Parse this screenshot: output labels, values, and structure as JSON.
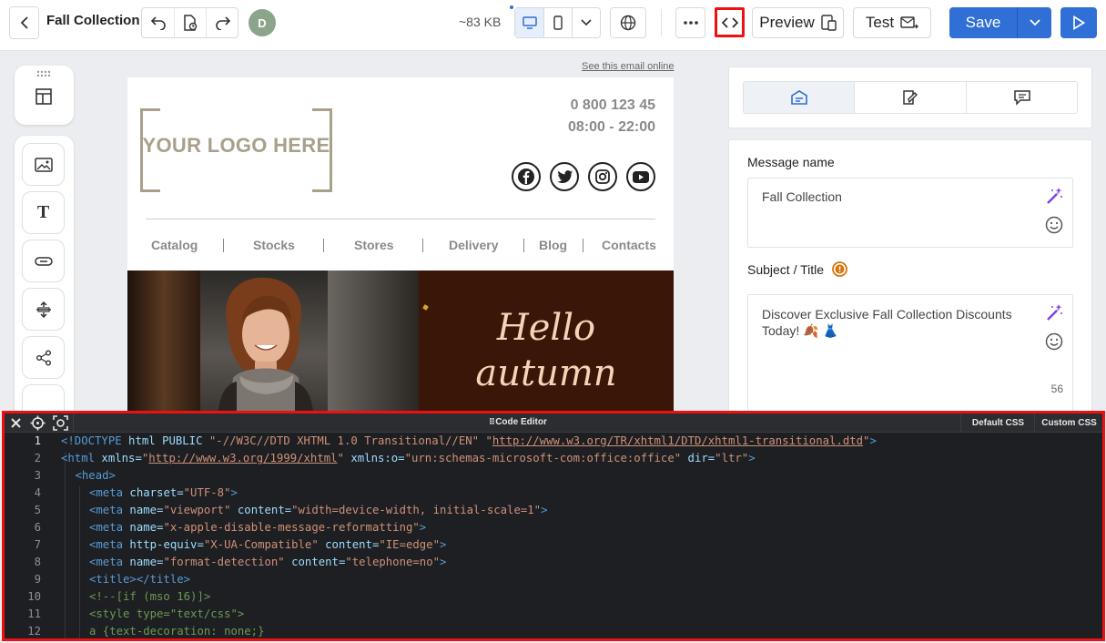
{
  "header": {
    "title": "Fall Collection",
    "avatar_initial": "D",
    "size": "~83 KB",
    "preview_label": "Preview",
    "test_label": "Test",
    "save_label": "Save"
  },
  "email": {
    "see_online": "See this email online",
    "logo_text": "YOUR LOGO HERE",
    "phone": "0 800 123 45",
    "hours": "08:00 - 22:00",
    "menu": [
      "Catalog",
      "Stocks",
      "Stores",
      "Delivery",
      "Blog",
      "Contacts"
    ],
    "hero_line1": "Hello",
    "hero_line2": "autumn"
  },
  "panel": {
    "message_name_label": "Message name",
    "message_name_value": "Fall Collection",
    "subject_label": "Subject / Title",
    "subject_value": "Discover Exclusive Fall Collection Discounts Today! 🍂 👗",
    "char_count": "56"
  },
  "editor": {
    "title": "Code Editor",
    "default_css": "Default CSS",
    "custom_css": "Custom CSS",
    "lines": [
      {
        "n": "1",
        "indent": 0,
        "parts": [
          [
            "tag",
            "<!DOCTYPE "
          ],
          [
            "attr",
            "html PUBLIC "
          ],
          [
            "str",
            "\"-//W3C//DTD XHTML 1.0 Transitional//EN\""
          ],
          [
            "plain",
            " "
          ],
          [
            "str",
            "\""
          ],
          [
            "url",
            "http://www.w3.org/TR/xhtml1/DTD/xhtml1-transitional.dtd"
          ],
          [
            "str",
            "\""
          ],
          [
            "tag",
            ">"
          ]
        ]
      },
      {
        "n": "2",
        "indent": 0,
        "parts": [
          [
            "tag",
            "<html "
          ],
          [
            "attr",
            "xmlns="
          ],
          [
            "str",
            "\""
          ],
          [
            "url",
            "http://www.w3.org/1999/xhtml"
          ],
          [
            "str",
            "\""
          ],
          [
            "attr",
            " xmlns:o="
          ],
          [
            "str",
            "\"urn:schemas-microsoft-com:office:office\""
          ],
          [
            "attr",
            " dir="
          ],
          [
            "str",
            "\"ltr\""
          ],
          [
            "tag",
            ">"
          ]
        ]
      },
      {
        "n": "3",
        "indent": 1,
        "parts": [
          [
            "tag",
            "<head>"
          ]
        ]
      },
      {
        "n": "4",
        "indent": 2,
        "parts": [
          [
            "tag",
            "<meta "
          ],
          [
            "attr",
            "charset="
          ],
          [
            "str",
            "\"UTF-8\""
          ],
          [
            "tag",
            ">"
          ]
        ]
      },
      {
        "n": "5",
        "indent": 2,
        "parts": [
          [
            "tag",
            "<meta "
          ],
          [
            "attr",
            "name="
          ],
          [
            "str",
            "\"viewport\""
          ],
          [
            "attr",
            " content="
          ],
          [
            "str",
            "\"width=device-width, initial-scale=1\""
          ],
          [
            "tag",
            ">"
          ]
        ]
      },
      {
        "n": "6",
        "indent": 2,
        "parts": [
          [
            "tag",
            "<meta "
          ],
          [
            "attr",
            "name="
          ],
          [
            "str",
            "\"x-apple-disable-message-reformatting\""
          ],
          [
            "tag",
            ">"
          ]
        ]
      },
      {
        "n": "7",
        "indent": 2,
        "parts": [
          [
            "tag",
            "<meta "
          ],
          [
            "attr",
            "http-equiv="
          ],
          [
            "str",
            "\"X-UA-Compatible\""
          ],
          [
            "attr",
            " content="
          ],
          [
            "str",
            "\"IE=edge\""
          ],
          [
            "tag",
            ">"
          ]
        ]
      },
      {
        "n": "8",
        "indent": 2,
        "parts": [
          [
            "tag",
            "<meta "
          ],
          [
            "attr",
            "name="
          ],
          [
            "str",
            "\"format-detection\""
          ],
          [
            "attr",
            " content="
          ],
          [
            "str",
            "\"telephone=no\""
          ],
          [
            "tag",
            ">"
          ]
        ]
      },
      {
        "n": "9",
        "indent": 2,
        "parts": [
          [
            "tag",
            "<title></title>"
          ]
        ]
      },
      {
        "n": "10",
        "indent": 2,
        "parts": [
          [
            "com",
            "<!--[if (mso 16)]>"
          ]
        ]
      },
      {
        "n": "11",
        "indent": 2,
        "parts": [
          [
            "com",
            "<style type=\"text/css\">"
          ]
        ]
      },
      {
        "n": "12",
        "indent": 2,
        "parts": [
          [
            "com",
            "a {text-decoration: none;}"
          ]
        ]
      }
    ]
  },
  "colors": {
    "primary": "#2f6fd6",
    "highlight": "#e11d1d",
    "hero_bg": "#3a1608",
    "hero_text": "#f6d3b8",
    "logo": "#a9a08b"
  }
}
